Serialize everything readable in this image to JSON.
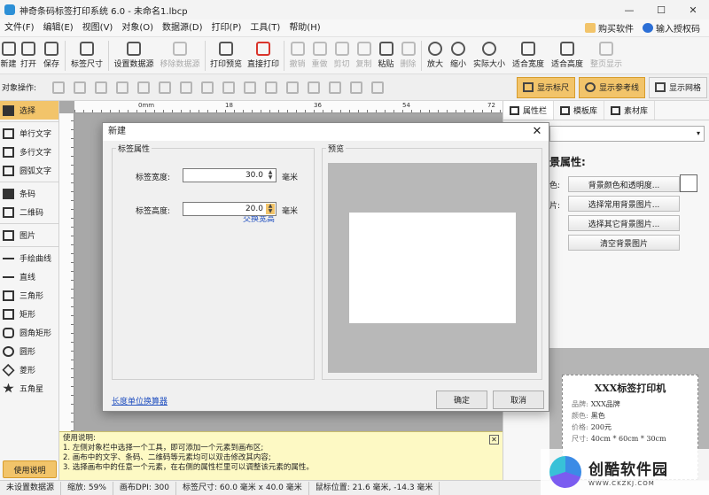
{
  "window": {
    "title": "神奇条码标签打印系统 6.0 - 未命名1.lbcp",
    "minimize": "—",
    "maximize": "☐",
    "close": "✕"
  },
  "menu": {
    "items": [
      "文件(F)",
      "编辑(E)",
      "视图(V)",
      "对象(O)",
      "数据源(D)",
      "打印(P)",
      "工具(T)",
      "帮助(H)"
    ],
    "buy": "购买软件",
    "license": "输入授权码"
  },
  "toolbar": {
    "buttons": [
      {
        "label": "新建",
        "icon": "new-file-icon",
        "enabled": true
      },
      {
        "label": "打开",
        "icon": "open-folder-icon",
        "enabled": true
      },
      {
        "label": "保存",
        "icon": "save-icon",
        "enabled": true
      },
      {
        "label": "标签尺寸",
        "icon": "label-size-icon",
        "enabled": true
      },
      {
        "label": "设置数据源",
        "icon": "database-icon",
        "enabled": true
      },
      {
        "label": "移除数据源",
        "icon": "database-remove-icon",
        "enabled": false
      },
      {
        "label": "打印预览",
        "icon": "print-preview-icon",
        "enabled": true
      },
      {
        "label": "直接打印",
        "icon": "printer-icon",
        "enabled": true
      },
      {
        "label": "撤销",
        "icon": "undo-icon",
        "enabled": false
      },
      {
        "label": "重做",
        "icon": "redo-icon",
        "enabled": false
      },
      {
        "label": "剪切",
        "icon": "cut-icon",
        "enabled": false
      },
      {
        "label": "复制",
        "icon": "copy-icon",
        "enabled": false
      },
      {
        "label": "粘贴",
        "icon": "paste-icon",
        "enabled": true
      },
      {
        "label": "删除",
        "icon": "delete-icon",
        "enabled": false
      },
      {
        "label": "放大",
        "icon": "zoom-in-icon",
        "enabled": true
      },
      {
        "label": "缩小",
        "icon": "zoom-out-icon",
        "enabled": true
      },
      {
        "label": "实际大小",
        "icon": "actual-size-icon",
        "enabled": true
      },
      {
        "label": "适合宽度",
        "icon": "fit-width-icon",
        "enabled": true
      },
      {
        "label": "适合高度",
        "icon": "fit-height-icon",
        "enabled": true
      },
      {
        "label": "整页显示",
        "icon": "full-page-icon",
        "enabled": false
      }
    ]
  },
  "objbar": {
    "label": "对象操作:",
    "toggles": [
      {
        "label": "显示标尺",
        "on": true
      },
      {
        "label": "显示参考线",
        "on": true
      },
      {
        "label": "显示网格",
        "on": false
      }
    ]
  },
  "tools": {
    "items": [
      {
        "label": "选择",
        "icon": "cursor-icon"
      },
      {
        "label": "单行文字",
        "icon": "text-line-icon"
      },
      {
        "label": "多行文字",
        "icon": "text-multiline-icon"
      },
      {
        "label": "圆弧文字",
        "icon": "arc-text-icon"
      },
      {
        "label": "条码",
        "icon": "barcode-icon"
      },
      {
        "label": "二维码",
        "icon": "qrcode-icon"
      },
      {
        "label": "图片",
        "icon": "image-icon"
      },
      {
        "label": "手绘曲线",
        "icon": "pen-icon"
      },
      {
        "label": "直线",
        "icon": "line-icon"
      },
      {
        "label": "三角形",
        "icon": "triangle-icon"
      },
      {
        "label": "矩形",
        "icon": "rectangle-icon"
      },
      {
        "label": "圆角矩形",
        "icon": "rounded-rect-icon"
      },
      {
        "label": "圆形",
        "icon": "circle-icon"
      },
      {
        "label": "菱形",
        "icon": "diamond-icon"
      },
      {
        "label": "五角星",
        "icon": "star-icon"
      }
    ],
    "help_button": "使用说明"
  },
  "ruler": {
    "labels": [
      "0mm",
      "18",
      "36",
      "54",
      "72"
    ]
  },
  "right_panel": {
    "tabs": [
      "属性栏",
      "模板库",
      "素材库"
    ],
    "title_fragment": "景属性:",
    "frag1": "色:",
    "frag2": "片:",
    "btn_bg_color": "背景颜色和透明度...",
    "btn_common_bg": "选择常用背景图片...",
    "btn_other_bg": "选择其它背景图片...",
    "btn_clear_bg": "清空背景图片",
    "label_title": "XXX标签打印机",
    "rows": [
      {
        "k": "品牌:",
        "v": "XXX品牌"
      },
      {
        "k": "颜色:",
        "v": "黑色"
      },
      {
        "k": "价格:",
        "v": "200元"
      },
      {
        "k": "尺寸:",
        "v": "40cm * 60cm * 30cm"
      }
    ]
  },
  "help_panel": {
    "lines": [
      "使用说明:",
      "1. 左侧对象栏中选择一个工具，即可添加一个元素到画布区;",
      "2. 画布中的文字、条码、二维码等元素均可以双击修改其内容;",
      "3. 选择画布中的任意一个元素，在右侧的属性栏里可以调整该元素的属性。"
    ],
    "close": "✕"
  },
  "status": {
    "items": [
      "未设置数据源",
      "缩放: 59%",
      "画布DPI: 300",
      "标签尺寸: 60.0 毫米 x 40.0 毫米",
      "鼠标位置: 21.6 毫米, -14.3 毫米"
    ]
  },
  "watermark": {
    "main": "创酷软件园",
    "url": "WWW.CKZKJ.COM"
  },
  "dialog": {
    "title": "新建",
    "close": "✕",
    "group_label": "标签属性",
    "preview_label": "预览",
    "width_label": "标签宽度:",
    "width_value": "30.0",
    "width_unit": "毫米",
    "swap_link": "交换宽高",
    "height_label": "标签高度:",
    "height_value": "20.0",
    "height_unit": "毫米",
    "unit_converter": "长度单位换算器",
    "ok": "确定",
    "cancel": "取消"
  },
  "colors": {
    "accent": "#f2c46a",
    "link": "#2150c0",
    "help_bg": "#fdf9c4"
  }
}
